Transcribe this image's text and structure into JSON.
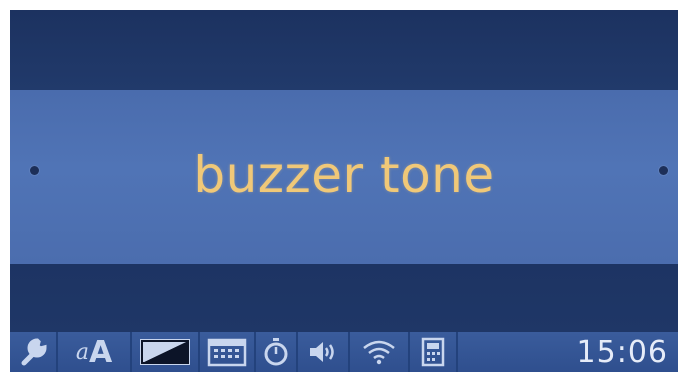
{
  "menu": {
    "selected_item": "buzzer tone"
  },
  "status_bar": {
    "icons": [
      {
        "name": "wrench-icon"
      },
      {
        "name": "font-size-icon",
        "small_glyph": "a",
        "big_glyph": "A"
      },
      {
        "name": "contrast-icon"
      },
      {
        "name": "calendar-icon"
      },
      {
        "name": "stopwatch-icon"
      },
      {
        "name": "volume-icon"
      },
      {
        "name": "wifi-icon"
      },
      {
        "name": "phone-book-icon"
      }
    ],
    "time": "15:06"
  },
  "colors": {
    "screen_background": "#20396a",
    "selection_bar": "#4e71b2",
    "title_text": "#f0c878",
    "status_bar": "#3a5c9c"
  }
}
